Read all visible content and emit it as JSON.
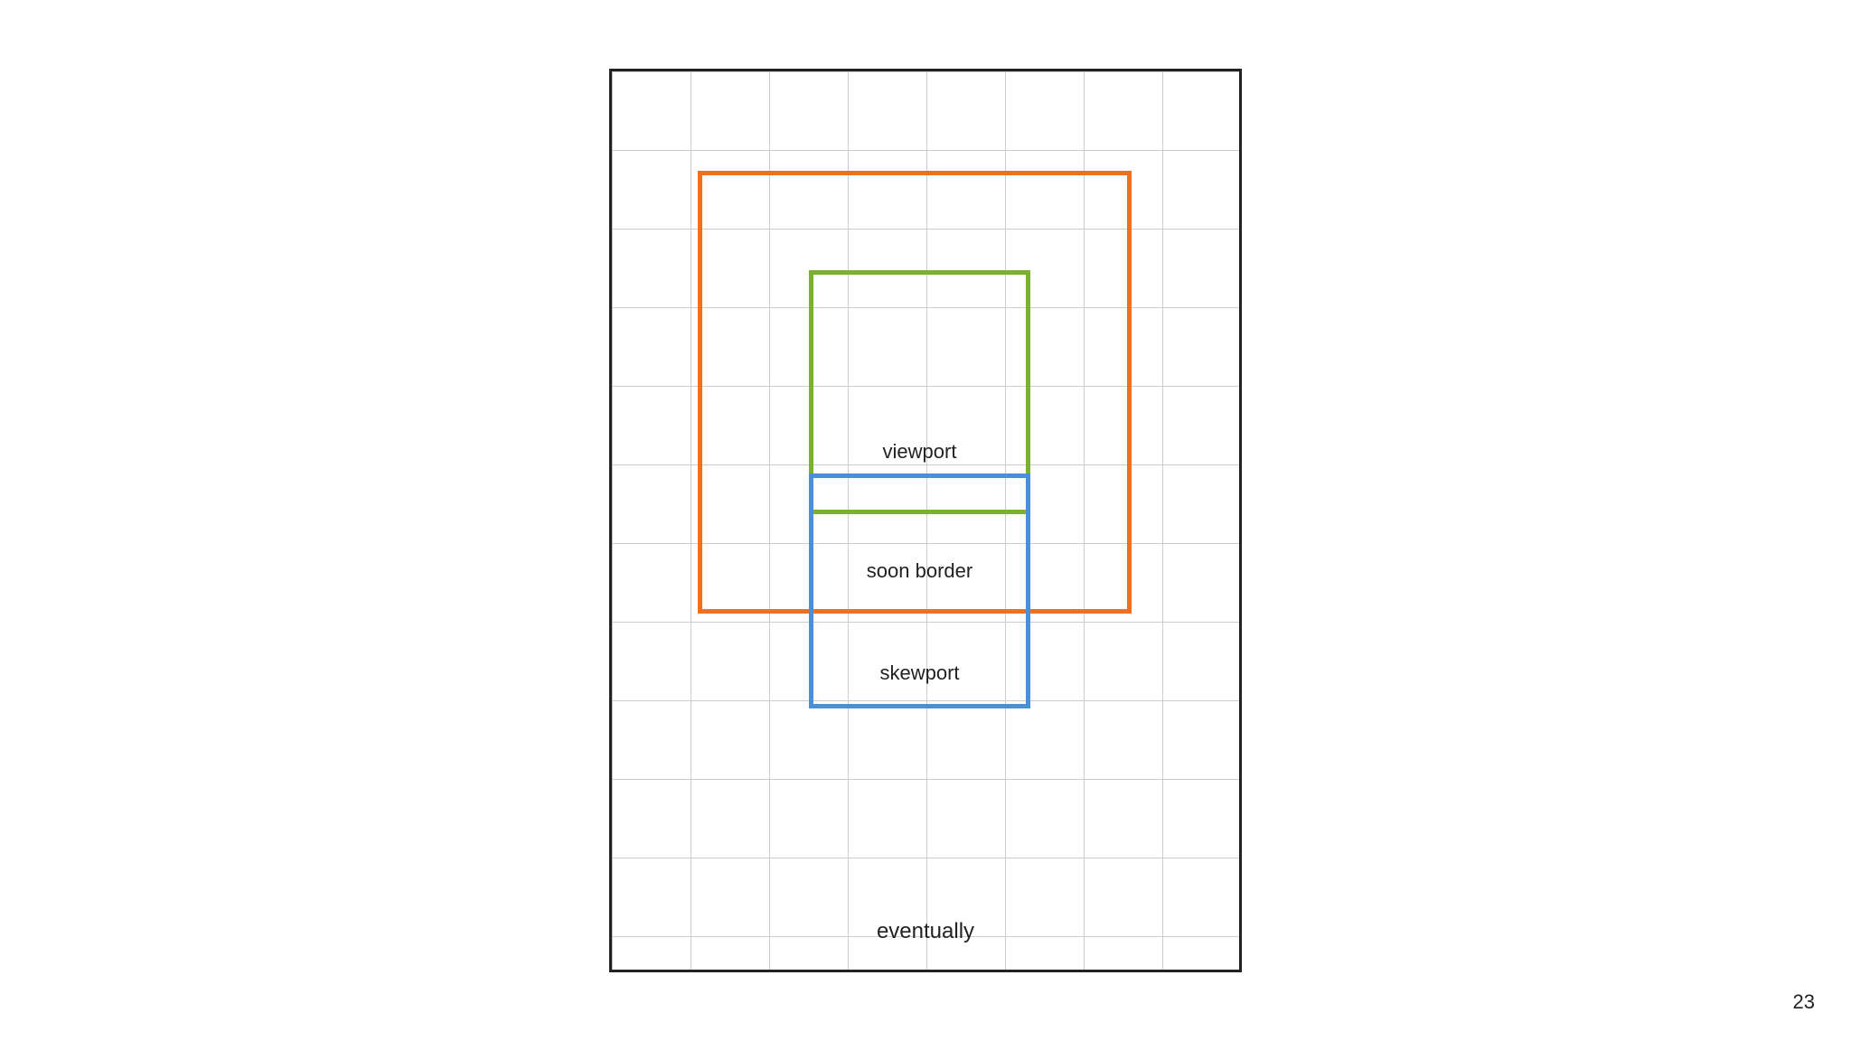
{
  "diagram": {
    "labels": {
      "viewport": "viewport",
      "soon_border": "soon border",
      "skewport": "skewport",
      "eventually": "eventually"
    },
    "colors": {
      "orange": "#f07020",
      "green": "#7cb030",
      "blue": "#4a90d9",
      "border": "#222222",
      "grid": "#cccccc"
    },
    "page_number": "23"
  }
}
